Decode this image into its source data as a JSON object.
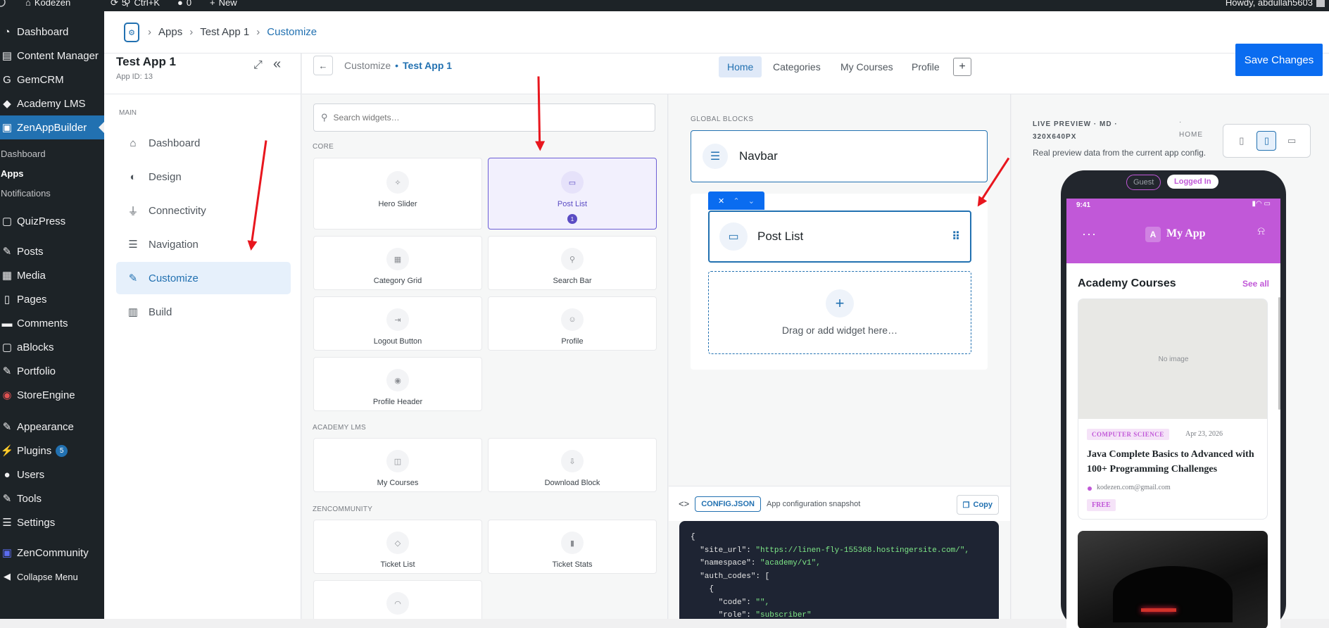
{
  "adminbar": {
    "site": "Kodezen",
    "updates": "5",
    "search": "Ctrl+K",
    "comments": "0",
    "new": "New",
    "howdy": "Howdy, abdullah5603"
  },
  "wpmenu": {
    "items": [
      {
        "label": "Dashboard",
        "icon": "gauge-icon"
      },
      {
        "label": "Content Manager",
        "icon": "content-icon"
      },
      {
        "label": "GemCRM",
        "icon": "crm-icon"
      },
      {
        "label": "Academy LMS",
        "icon": "academy-icon"
      },
      {
        "label": "ZenAppBuilder",
        "icon": "zen-icon"
      },
      {
        "label": "QuizPress",
        "icon": "quiz-icon"
      },
      {
        "label": "Posts",
        "icon": "pin-icon"
      },
      {
        "label": "Media",
        "icon": "media-icon"
      },
      {
        "label": "Pages",
        "icon": "pages-icon"
      },
      {
        "label": "Comments",
        "icon": "comment-icon"
      },
      {
        "label": "aBlocks",
        "icon": "blocks-icon"
      },
      {
        "label": "Portfolio",
        "icon": "pin-icon"
      },
      {
        "label": "StoreEngine",
        "icon": "store-icon"
      },
      {
        "label": "Appearance",
        "icon": "brush-icon"
      },
      {
        "label": "Plugins",
        "icon": "plugin-icon",
        "badge": "5"
      },
      {
        "label": "Users",
        "icon": "user-icon"
      },
      {
        "label": "Tools",
        "icon": "wrench-icon"
      },
      {
        "label": "Settings",
        "icon": "settings-icon"
      },
      {
        "label": "ZenCommunity",
        "icon": "community-icon"
      },
      {
        "label": "Collapse Menu",
        "icon": "collapse-icon"
      }
    ],
    "submenu": [
      "Dashboard",
      "Apps",
      "Notifications"
    ]
  },
  "breadcrumb": {
    "apps": "Apps",
    "app": "Test App 1",
    "current": "Customize"
  },
  "app": {
    "name": "Test App 1",
    "id": "App ID: 13"
  },
  "leftnav": {
    "section": "MAIN",
    "items": [
      "Dashboard",
      "Design",
      "Connectivity",
      "Navigation",
      "Customize",
      "Build"
    ]
  },
  "subhead": {
    "back": "Customize",
    "dot": "•",
    "app": "Test App 1",
    "tabs": [
      "Home",
      "Categories",
      "My Courses",
      "Profile"
    ],
    "save": "Save Changes"
  },
  "widgets": {
    "search_placeholder": "Search widgets…",
    "sections": [
      "CORE",
      "ACADEMY LMS",
      "ZENCOMMUNITY"
    ],
    "core": [
      "Hero Slider",
      "Post List",
      "Category Grid",
      "Search Bar",
      "Logout Button",
      "Profile",
      "Profile Header"
    ],
    "post_list_count": "1",
    "academy": [
      "My Courses",
      "Download Block"
    ],
    "community": [
      "Ticket List",
      "Ticket Stats"
    ]
  },
  "canvas": {
    "global_blocks": "GLOBAL BLOCKS",
    "navbar": "Navbar",
    "post_list": "Post List",
    "drop": "Drag or add widget here…"
  },
  "config": {
    "tag": "CONFIG.JSON",
    "desc": "App configuration snapshot",
    "copy": "Copy",
    "lines": [
      "{",
      "  \"site_url\": \"https://linen-fly-155368.hostingersite.com/\",",
      "  \"namespace\": \"academy/v1\",",
      "  \"auth_codes\": [",
      "    {",
      "      \"code\": \"\",",
      "      \"role\": \"subscriber\""
    ]
  },
  "preview": {
    "title": "LIVE PREVIEW · MD · 320X640PX",
    "dot": "·",
    "home": "HOME",
    "desc": "Real preview data from the current app config.",
    "guest": "Guest",
    "logged": "Logged In",
    "time": "9:41",
    "app_letter": "A",
    "app_name": "My App",
    "section": "Academy Courses",
    "see_all": "See all",
    "no_image": "No image",
    "course": {
      "category": "COMPUTER SCIENCE",
      "date": "Apr 23, 2026",
      "title": "Java Complete Basics to Advanced with 100+ Programming Challenges",
      "author": "kodezen.com@gmail.com",
      "price": "FREE"
    },
    "accent": "#c158d8"
  }
}
